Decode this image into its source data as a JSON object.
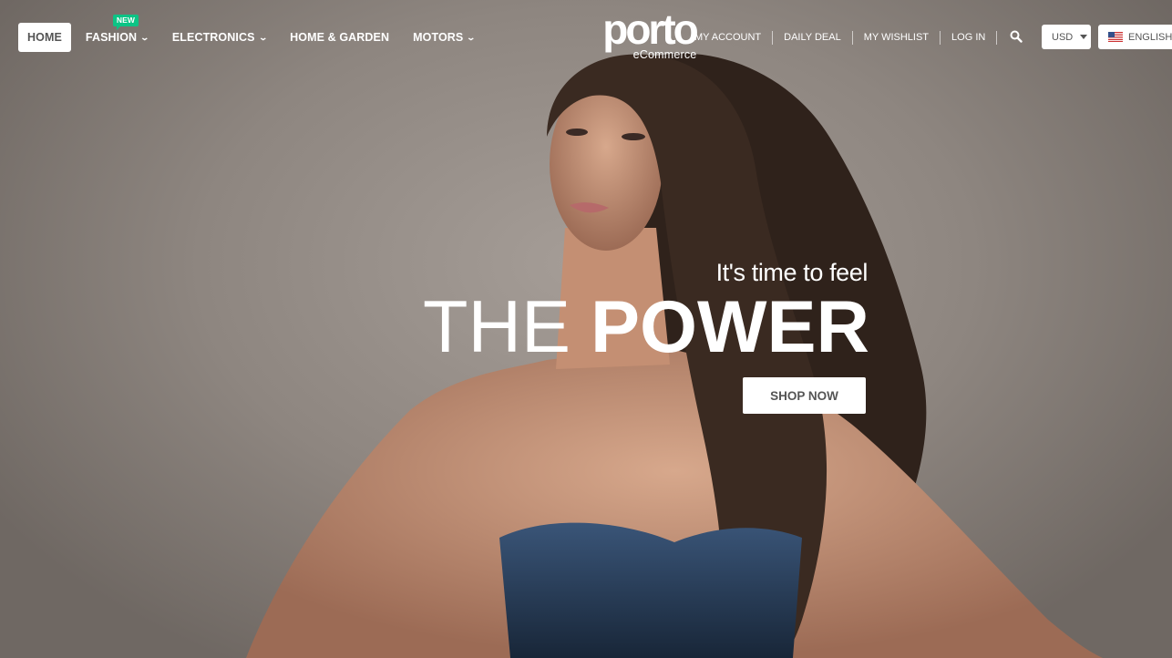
{
  "nav": {
    "items": [
      {
        "label": "HOME",
        "active": true,
        "dropdown": false
      },
      {
        "label": "FASHION",
        "badge": "NEW",
        "dropdown": true
      },
      {
        "label": "ELECTRONICS",
        "dropdown": true
      },
      {
        "label": "HOME & GARDEN",
        "dropdown": false
      },
      {
        "label": "MOTORS",
        "dropdown": true
      }
    ]
  },
  "logo": {
    "main": "porto",
    "sub": "eCommerce"
  },
  "top_links": [
    "MY ACCOUNT",
    "DAILY DEAL",
    "MY WISHLIST",
    "LOG IN"
  ],
  "currency": {
    "selected": "USD"
  },
  "language": {
    "selected": "ENGLISH",
    "flag_icon": "us-flag-icon"
  },
  "hero": {
    "tagline": "It's time to feel",
    "headline_light": "THE",
    "headline_bold": "POWER",
    "cta_label": "SHOP NOW"
  },
  "colors": {
    "badge": "#0cc485",
    "button_text": "#555555",
    "background": "#8f8782"
  }
}
